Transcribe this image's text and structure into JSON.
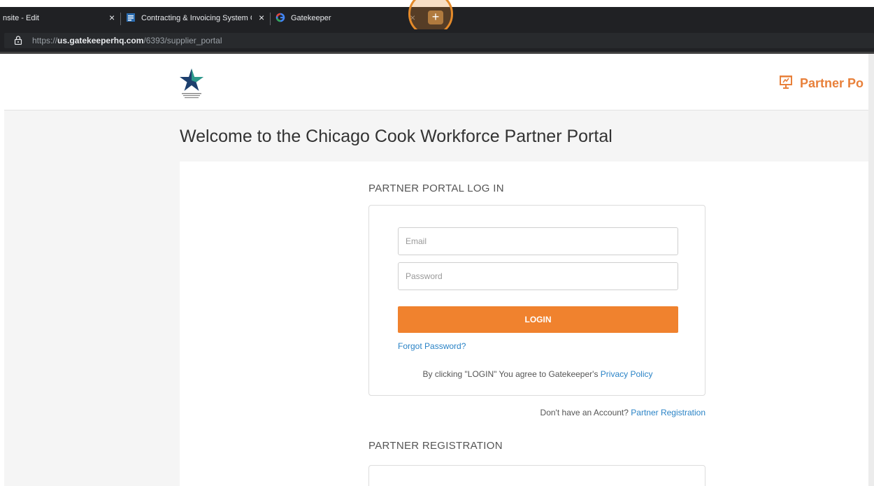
{
  "browser": {
    "tabs": [
      {
        "label": "nsite - Edit"
      },
      {
        "label": "Contracting & Invoicing System C"
      },
      {
        "label": "Gatekeeper"
      }
    ],
    "new_tab_symbol": "+",
    "close_symbol": "×",
    "url_scheme": "https://",
    "url_host": "us.gatekeeperhq.com",
    "url_path": "/6393/supplier_portal"
  },
  "header": {
    "logo_icon": "star-logo-icon",
    "portal_link_label": "Partner Po",
    "portal_icon": "presentation-icon"
  },
  "page": {
    "welcome": "Welcome to the Chicago Cook Workforce Partner Portal"
  },
  "login": {
    "title": "PARTNER PORTAL LOG IN",
    "email_placeholder": "Email",
    "password_placeholder": "Password",
    "login_button": "LOGIN",
    "forgot_password": "Forgot Password?",
    "agree_text": "By clicking \"LOGIN\" You agree to Gatekeeper's",
    "privacy_policy": "Privacy Policy",
    "no_account_text": "Don't have an Account?",
    "partner_registration_link": "Partner Registration"
  },
  "registration": {
    "title": "PARTNER REGISTRATION"
  },
  "colors": {
    "accent": "#f0822e",
    "link": "#2a83c6",
    "browser_chrome": "#202124"
  }
}
